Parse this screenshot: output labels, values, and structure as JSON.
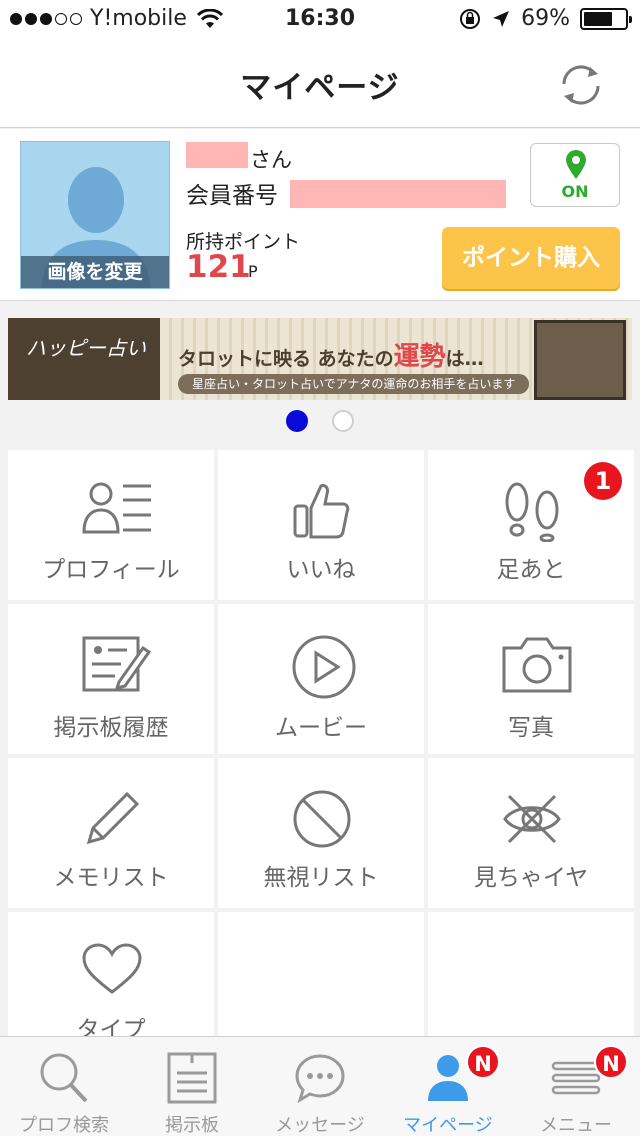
{
  "status_bar": {
    "carrier": "Y!mobile",
    "time": "16:30",
    "battery": "69%",
    "battery_level": 0.69
  },
  "header": {
    "title": "マイページ",
    "refresh_icon": "refresh-icon"
  },
  "profile": {
    "avatar_button": "画像を変更",
    "name_suffix": "さん",
    "member_number_label": "会員番号",
    "points_label": "所持ポイント",
    "points_value": "121",
    "points_unit": "P",
    "status_toggle": "ON",
    "buy_points_button": "ポイント購入"
  },
  "banner": {
    "logo": "ハッピー占い",
    "heading_prefix": "タロットに映る あなたの",
    "heading_highlight": "運勢",
    "heading_suffix": "は…",
    "subtext": "星座占い・タロット占いでアナタの運命のお相手を占います"
  },
  "carousel": {
    "pages": 2,
    "active": 0
  },
  "menu": {
    "items": [
      {
        "label": "プロフィール",
        "icon": "profile-list-icon"
      },
      {
        "label": "いいね",
        "icon": "thumbs-up-icon"
      },
      {
        "label": "足あと",
        "icon": "footprints-icon",
        "badge": "1"
      },
      {
        "label": "掲示板履歴",
        "icon": "board-history-icon"
      },
      {
        "label": "ムービー",
        "icon": "play-icon"
      },
      {
        "label": "写真",
        "icon": "camera-icon"
      },
      {
        "label": "メモリスト",
        "icon": "pencil-icon"
      },
      {
        "label": "無視リスト",
        "icon": "block-icon"
      },
      {
        "label": "見ちゃイヤ",
        "icon": "eye-off-icon"
      },
      {
        "label": "タイプ",
        "icon": "heart-icon"
      }
    ]
  },
  "tab_bar": {
    "tabs": [
      {
        "label": "プロフ検索",
        "icon": "search-icon"
      },
      {
        "label": "掲示板",
        "icon": "board-icon"
      },
      {
        "label": "メッセージ",
        "icon": "message-icon"
      },
      {
        "label": "マイページ",
        "icon": "user-icon",
        "badge": "N",
        "active": true
      },
      {
        "label": "メニュー",
        "icon": "menu-icon",
        "badge": "N"
      }
    ]
  },
  "colors": {
    "accent_blue": "#3d9be9",
    "points_red": "#e0474c",
    "buy_button": "#fcc54a",
    "badge_red": "#e8151f",
    "on_green": "#2eaa2e"
  }
}
